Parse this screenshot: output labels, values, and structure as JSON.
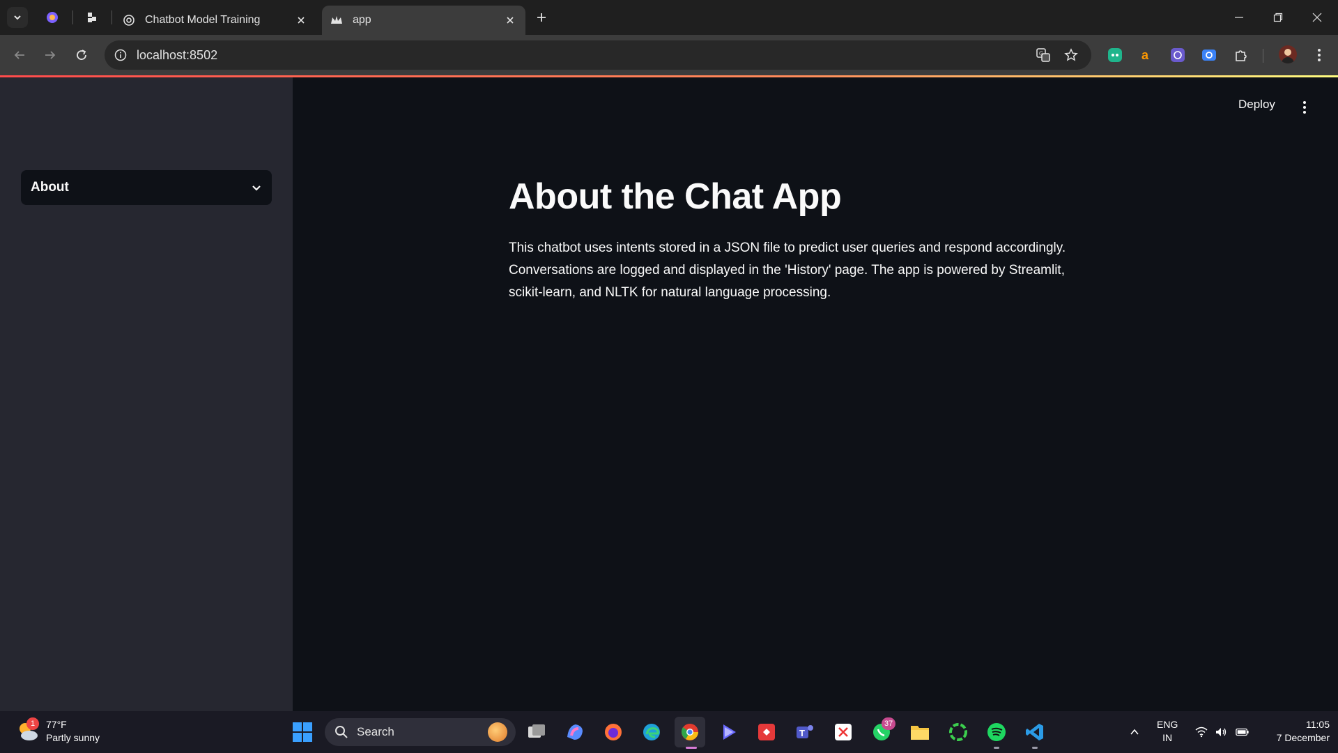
{
  "browser": {
    "tabs": [
      {
        "title": "Chatbot Model Training",
        "icon": "openai-icon",
        "active": false
      },
      {
        "title": "app",
        "icon": "streamlit-crown-icon",
        "active": true
      }
    ],
    "pinned_tabs": [
      "copilot-tab-icon",
      "replit-tab-icon"
    ],
    "url": "localhost:8502"
  },
  "streamlit": {
    "sidebar": {
      "select_value": "About"
    },
    "header": {
      "deploy_label": "Deploy"
    },
    "page": {
      "title": "About the Chat App",
      "body": "This chatbot uses intents stored in a JSON file to predict user queries and respond accordingly. Conversations are logged and displayed in the 'History' page. The app is powered by Streamlit, scikit-learn, and NLTK for natural language processing."
    }
  },
  "taskbar": {
    "weather": {
      "temp": "77°F",
      "condition": "Partly sunny",
      "badge": "1"
    },
    "search_label": "Search",
    "whatsapp_badge": "37",
    "language": {
      "line1": "ENG",
      "line2": "IN"
    },
    "clock": {
      "time": "11:05",
      "date": "7 December"
    }
  },
  "colors": {
    "sidebar_bg": "#262730",
    "main_bg": "#0e1117",
    "accent_line": "#ff4b4b"
  }
}
